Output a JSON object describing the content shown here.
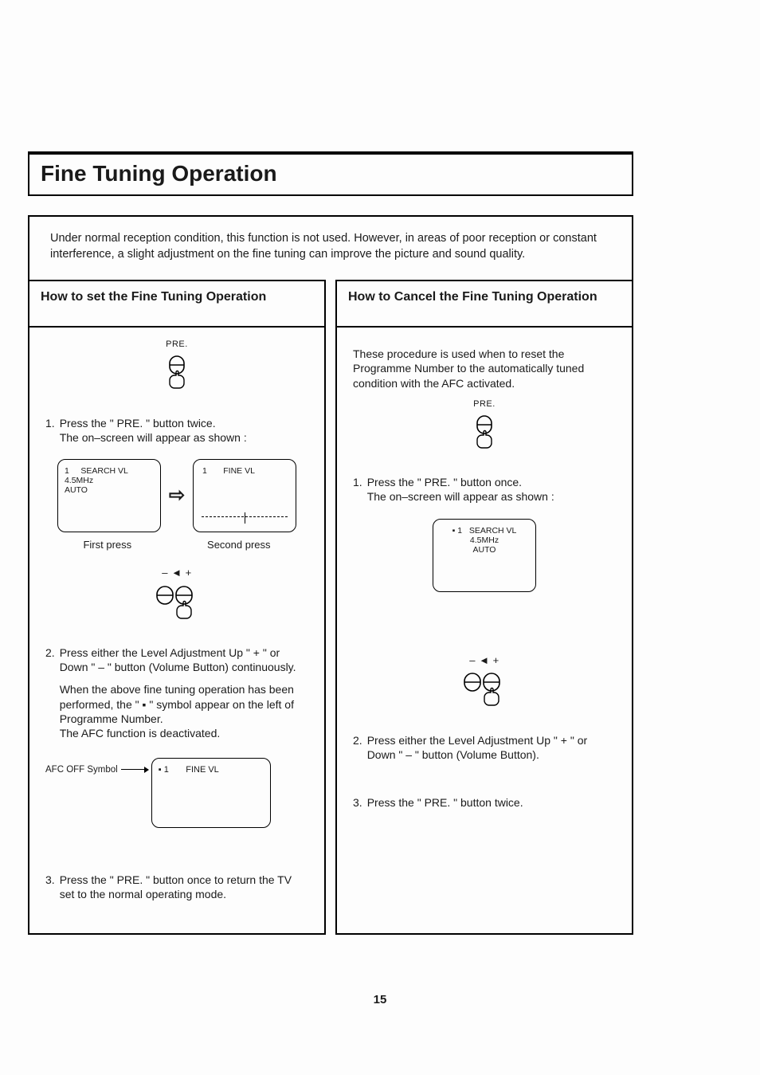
{
  "title": "Fine Tuning Operation",
  "intro": "Under normal reception condition, this function is not used. However, in areas of poor reception or constant interference, a slight adjustment on the fine tuning can improve the picture and sound quality.",
  "left": {
    "heading": "How to set the Fine Tuning Operation",
    "pre_label": "PRE.",
    "step1_num": "1.",
    "step1": "Press the \" PRE. \" button twice.\nThe on–screen will appear as shown :",
    "screen1_line1": "1",
    "screen1_line1b": "SEARCH VL",
    "screen1_line2": "4.5MHz",
    "screen1_line3": "AUTO",
    "screen2_line1": "1",
    "screen2_line1b": "FINE VL",
    "caption1": "First press",
    "caption2": "Second  press",
    "vol_label": "– ◄ +",
    "step2_num": "2.",
    "step2": "Press either the Level Adjustment Up \" + \" or   Down \" – \" button (Volume Button) continuously.",
    "step2_para": "When the above fine tuning operation has been performed, the \" ▪ \" symbol appear on the left of Programme Number.\nThe AFC function is deactivated.",
    "afc_label": "AFC OFF Symbol",
    "screen3_line1": "▪ 1",
    "screen3_line1b": "FINE VL",
    "step3_num": "3.",
    "step3": "Press the \" PRE. \" button once to return the TV  set to the normal operating mode."
  },
  "right": {
    "heading": "How to Cancel the Fine Tuning Operation",
    "intro": "These procedure is used  when to reset the Programme Number to the automatically tuned condition with the AFC activated.",
    "pre_label": "PRE.",
    "step1_num": "1.",
    "step1": "Press the \" PRE. \" button once.\nThe on–screen will appear as shown :",
    "screen_line1": "▪ 1",
    "screen_line1b": "SEARCH VL",
    "screen_line2": "4.5MHz",
    "screen_line3": "AUTO",
    "vol_label": "– ◄ +",
    "step2_num": "2.",
    "step2": "Press either the Level Adjustment Up \" + \" or Down \" – \" button (Volume Button).",
    "step3_num": "3.",
    "step3": "Press the \" PRE. \" button twice."
  },
  "page_number": "15"
}
